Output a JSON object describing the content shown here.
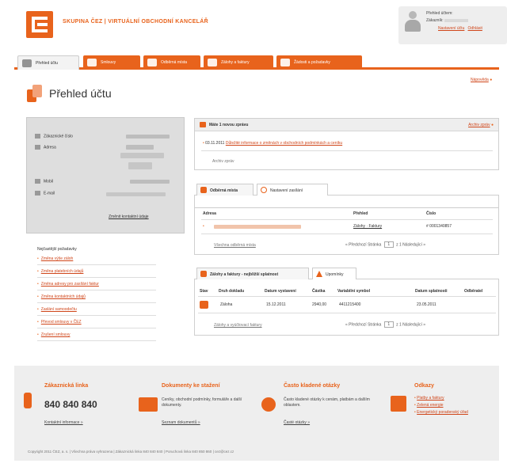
{
  "header": {
    "brand": "SKUPINA ČEZ | VIRTUÁLNÍ OBCHODNÍ KANCELÁŘ",
    "user": {
      "line1": "Přehled účtem:",
      "line2": "Zákazník:",
      "link_a": "Nastavení účtu",
      "link_b": "Odhlásit"
    }
  },
  "tabs": [
    {
      "label": "Přehled účtu",
      "active": true
    },
    {
      "label": "Smlouvy",
      "active": false
    },
    {
      "label": "Odběrná místa",
      "active": false
    },
    {
      "label": "Zálohy a faktury",
      "active": false
    },
    {
      "label": "Žádosti a požadavky",
      "active": false
    }
  ],
  "page": {
    "title": "Přehled účtu",
    "help": "Nápověda"
  },
  "personal_info": {
    "rows": [
      {
        "label": "Zákaznické číslo"
      },
      {
        "label": "Adresa"
      },
      {
        "label": "Mobil"
      },
      {
        "label": "E-mail"
      }
    ],
    "edit_link": "Změnit kontaktní údaje"
  },
  "contacts": {
    "title": "Nejčastější požadavky",
    "items": [
      "Změna výše záloh",
      "Změna platebních údajů",
      "Změna adresy pro zasílání faktur",
      "Změna kontaktních údajů",
      "Zaslání samoodečtu",
      "Převod smlouvy v ČEZ",
      "Zrušení smlouvy"
    ]
  },
  "messages": {
    "header": "Máte 1 novou zprávu",
    "all_link": "Archiv zpráv",
    "item_date": "03.11.2011",
    "item_text": "Důležité informace o změnách v obchodních podmínkách a ceníku",
    "more": "Archiv zpráv"
  },
  "places": {
    "tab_active": "Odběrná místa",
    "tab_inactive": "Nastavení zasílání",
    "columns": [
      "Adresa",
      "Přehled",
      "Číslo"
    ],
    "row": {
      "link": "Zálohy · Faktury",
      "number": "# 0001340857"
    },
    "list_link": "Všechna odběrná místa",
    "pager": {
      "prev": "« Předchozí",
      "label": "Stránka",
      "value": "1",
      "of": "z 1",
      "next": "Následující »"
    }
  },
  "invoices": {
    "tab_active": "Zálohy a faktury - nejbližší splatnost",
    "tab_inactive": "Upomínky",
    "columns": [
      "Stav",
      "Druh dokladu",
      "Datum vystavení",
      "Částka",
      "Variabilní symbol",
      "Datum splatnosti",
      "Odběratel"
    ],
    "row": {
      "type": "Záloha",
      "issued": "15.12.2011",
      "amount": "2940,00",
      "vs": "4411215400",
      "due": "23.05.2011"
    },
    "list_link": "Zálohy a vyúčtovací faktury",
    "pager": {
      "prev": "« Předchozí",
      "label": "Stránka",
      "value": "1",
      "of": "z 1",
      "next": "Následující »"
    }
  },
  "footer": {
    "hotline_title": "Zákaznická linka",
    "hotline_number": "840 840 840",
    "hotline_link": "Kontaktní informace »",
    "docs_title": "Dokumenty ke stažení",
    "docs_text": "Ceníky, obchodní podmínky, formuláře a další dokumenty.",
    "docs_link": "Seznam dokumentů »",
    "faq_title": "Často kladené otázky",
    "faq_text": "Často kladené otázky k cenám, platbám a dalším oblastem.",
    "faq_link": "Časté otázky »",
    "links_title": "Odkazy",
    "links": [
      "Platby a faktury",
      "Zelená energie",
      "Energetický poradenský úřad"
    ],
    "copyright": "Copyright 2011 ČEZ, a. s. | Všechna práva vyhrazena | Zákaznická linka 840 840 840 | Poruchová linka 840 850 860 | cez@cez.cz"
  },
  "colors": {
    "accent": "#e8631c",
    "footer_bg": "#eeeeee",
    "panel_head": "#eeeeee"
  }
}
